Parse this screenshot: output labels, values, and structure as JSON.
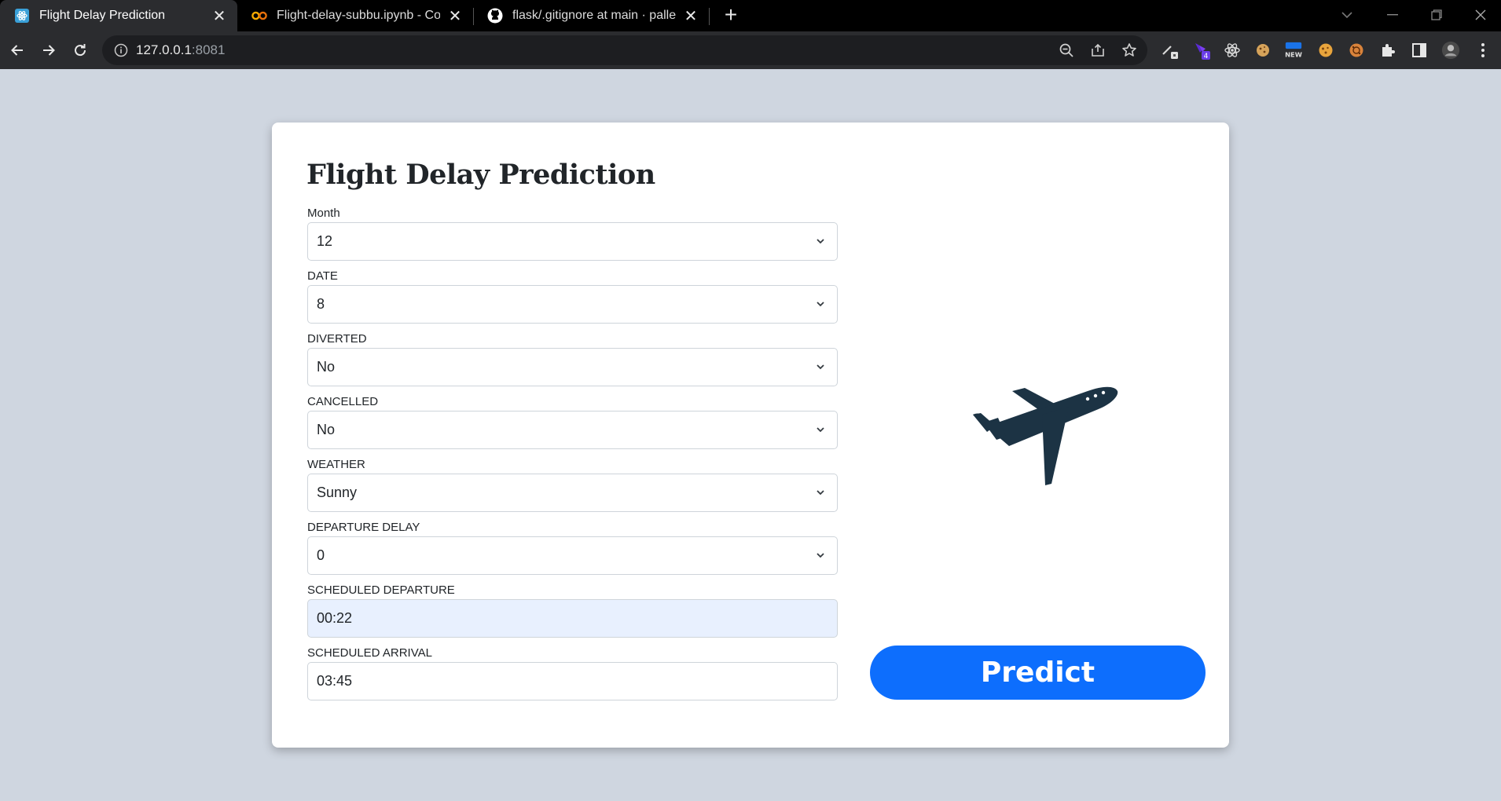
{
  "browser": {
    "tabs": [
      {
        "title": "Flight Delay Prediction",
        "favicon": "react-icon",
        "active": true
      },
      {
        "title": "Flight-delay-subbu.ipynb - Colab",
        "favicon": "colab-icon",
        "active": false
      },
      {
        "title": "flask/.gitignore at main · pallets/f",
        "favicon": "github-icon",
        "active": false
      }
    ],
    "url_host": "127.0.0.1",
    "url_port": ":8081",
    "extension_badge": "4",
    "extension_new_label": "NEW"
  },
  "form": {
    "title": "Flight Delay Prediction",
    "fields": [
      {
        "label": "Month",
        "type": "select",
        "value": "12"
      },
      {
        "label": "DATE",
        "type": "select",
        "value": "8"
      },
      {
        "label": "DIVERTED",
        "type": "select",
        "value": "No"
      },
      {
        "label": "CANCELLED",
        "type": "select",
        "value": "No"
      },
      {
        "label": "WEATHER",
        "type": "select",
        "value": "Sunny"
      },
      {
        "label": "DEPARTURE DELAY",
        "type": "select",
        "value": "0"
      },
      {
        "label": "SCHEDULED DEPARTURE",
        "type": "input",
        "value": "00:22"
      },
      {
        "label": "SCHEDULED ARRIVAL",
        "type": "input",
        "value": "03:45"
      }
    ],
    "predict_label": "Predict",
    "image": "airplane-icon",
    "colors": {
      "accent": "#0d6efd",
      "plane": "#1c3344",
      "background": "#cfd6e0"
    }
  }
}
